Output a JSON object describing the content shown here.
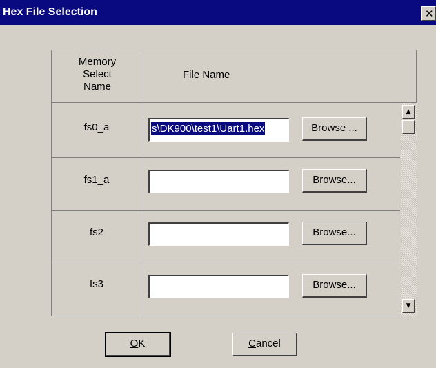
{
  "window": {
    "title": "Hex File Selection",
    "close_glyph": "✕"
  },
  "table": {
    "col_memory_lines": [
      "Memory",
      "Select",
      "Name"
    ],
    "col_file": "File Name",
    "rows": [
      {
        "name": "fs0_a",
        "file_value": "s\\DK900\\test1\\Uart1.hex",
        "browse_label": "Browse ..."
      },
      {
        "name": "fs1_a",
        "file_value": "",
        "browse_label": "Browse..."
      },
      {
        "name": "fs2",
        "file_value": "",
        "browse_label": "Browse..."
      },
      {
        "name": "fs3",
        "file_value": "",
        "browse_label": "Browse..."
      }
    ]
  },
  "scrollbar": {
    "up_glyph": "▲",
    "down_glyph": "▼"
  },
  "buttons": {
    "ok_mnemonic": "O",
    "ok_rest": "K",
    "cancel_mnemonic": "C",
    "cancel_rest": "ancel"
  },
  "colors": {
    "titlebar": "#0a0a80",
    "dialog_face": "#d4d0c8",
    "selection": "#0a0a80"
  }
}
